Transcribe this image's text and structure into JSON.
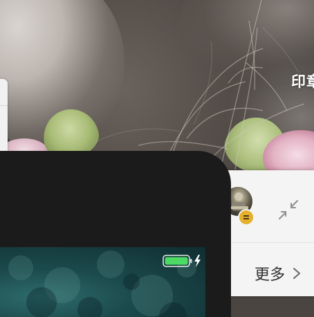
{
  "wallpaper": {
    "description_icon": "desktop-wallpaper-icon"
  },
  "menu_caption": {
    "text": "印章"
  },
  "side_panel": {
    "avatar_icon": "user-avatar-icon",
    "badge_icon": "menu-badge-icon",
    "collapse_icon": "collapse-arrows-icon",
    "more_label": "更多",
    "more_icon": "chevron-right-icon"
  },
  "phone": {
    "battery_icon": "battery-charging-icon",
    "battery_color": "#4cd964"
  }
}
